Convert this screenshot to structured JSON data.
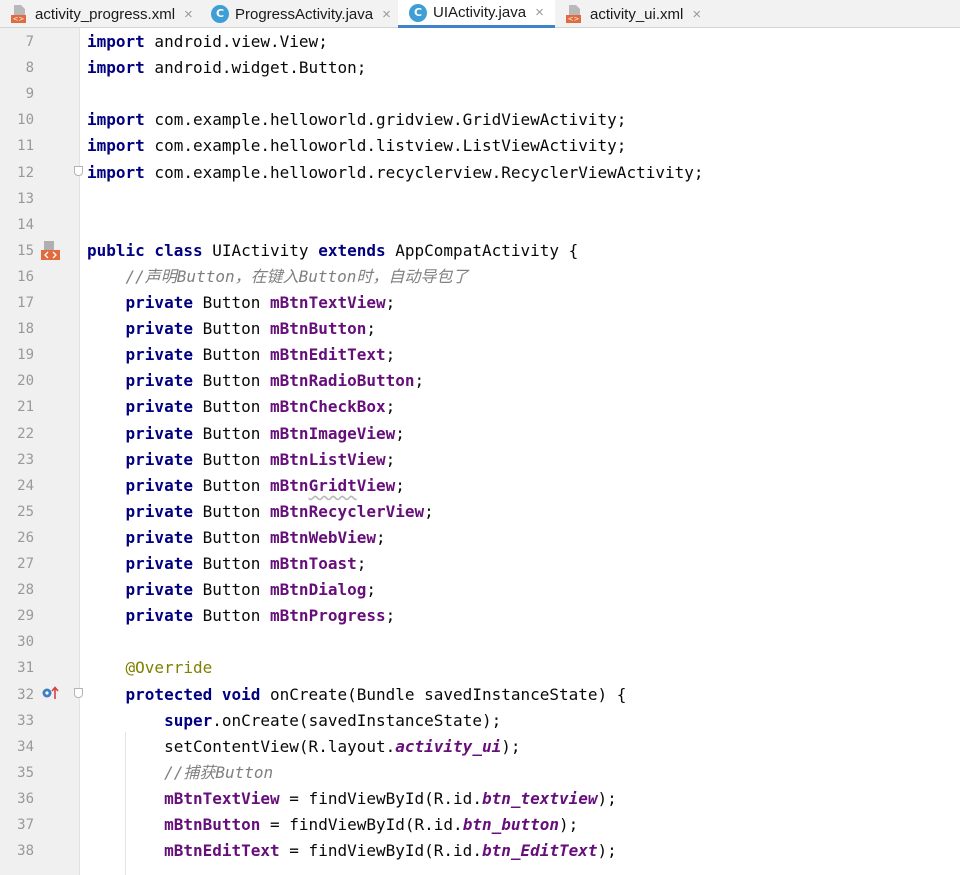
{
  "tabs": [
    {
      "label": "activity_progress.xml",
      "icon": "xml-file-icon",
      "active": false
    },
    {
      "label": "ProgressActivity.java",
      "icon": "java-class-icon",
      "active": false
    },
    {
      "label": "UIActivity.java",
      "icon": "java-class-icon",
      "active": true
    },
    {
      "label": "activity_ui.xml",
      "icon": "xml-file-icon",
      "active": false
    }
  ],
  "tab_close_glyph": "×",
  "icon_text": {
    "class_letter": "C",
    "xml_badge": "<>"
  },
  "editor": {
    "line_numbers": [
      "7",
      "8",
      "9",
      "10",
      "11",
      "12",
      "13",
      "14",
      "15",
      "16",
      "17",
      "18",
      "19",
      "20",
      "21",
      "22",
      "23",
      "24",
      "25",
      "26",
      "27",
      "28",
      "29",
      "30",
      "31",
      "32",
      "33",
      "34",
      "35",
      "36",
      "37",
      "38"
    ],
    "lines": [
      [
        {
          "t": "import",
          "c": "kw"
        },
        {
          "t": " android.view.View;"
        }
      ],
      [
        {
          "t": "import",
          "c": "kw"
        },
        {
          "t": " android.widget.Button;"
        }
      ],
      [],
      [
        {
          "t": "import",
          "c": "kw"
        },
        {
          "t": " com.example.helloworld.gridview.GridViewActivity;"
        }
      ],
      [
        {
          "t": "import",
          "c": "kw"
        },
        {
          "t": " com.example.helloworld.listview.ListViewActivity;"
        }
      ],
      [
        {
          "t": "import",
          "c": "kw"
        },
        {
          "t": " com.example.helloworld.recyclerview.RecyclerViewActivity;"
        }
      ],
      [],
      [],
      [
        {
          "t": "public class",
          "c": "kw"
        },
        {
          "t": " UIActivity "
        },
        {
          "t": "extends",
          "c": "kw"
        },
        {
          "t": " AppCompatActivity {"
        }
      ],
      [
        {
          "t": "    "
        },
        {
          "t": "//声明Button，在键入Button时，自动导包了",
          "c": "cmt"
        }
      ],
      [
        {
          "t": "    "
        },
        {
          "t": "private",
          "c": "kw"
        },
        {
          "t": " Button "
        },
        {
          "t": "mBtnTextView",
          "c": "fld"
        },
        {
          "t": ";"
        }
      ],
      [
        {
          "t": "    "
        },
        {
          "t": "private",
          "c": "kw"
        },
        {
          "t": " Button "
        },
        {
          "t": "mBtnButton",
          "c": "fld"
        },
        {
          "t": ";"
        }
      ],
      [
        {
          "t": "    "
        },
        {
          "t": "private",
          "c": "kw"
        },
        {
          "t": " Button "
        },
        {
          "t": "mBtnEditText",
          "c": "fld"
        },
        {
          "t": ";"
        }
      ],
      [
        {
          "t": "    "
        },
        {
          "t": "private",
          "c": "kw"
        },
        {
          "t": " Button "
        },
        {
          "t": "mBtnRadioButton",
          "c": "fld"
        },
        {
          "t": ";"
        }
      ],
      [
        {
          "t": "    "
        },
        {
          "t": "private",
          "c": "kw"
        },
        {
          "t": " Button "
        },
        {
          "t": "mBtnCheckBox",
          "c": "fld"
        },
        {
          "t": ";"
        }
      ],
      [
        {
          "t": "    "
        },
        {
          "t": "private",
          "c": "kw"
        },
        {
          "t": " Button "
        },
        {
          "t": "mBtnImageView",
          "c": "fld"
        },
        {
          "t": ";"
        }
      ],
      [
        {
          "t": "    "
        },
        {
          "t": "private",
          "c": "kw"
        },
        {
          "t": " Button "
        },
        {
          "t": "mBtnListView",
          "c": "fld"
        },
        {
          "t": ";"
        }
      ],
      [
        {
          "t": "    "
        },
        {
          "t": "private",
          "c": "kw"
        },
        {
          "t": " Button "
        },
        {
          "t": "mBtn",
          "c": "fld"
        },
        {
          "t": "Gridt",
          "c": "fld squig"
        },
        {
          "t": "View",
          "c": "fld"
        },
        {
          "t": ";"
        }
      ],
      [
        {
          "t": "    "
        },
        {
          "t": "private",
          "c": "kw"
        },
        {
          "t": " Button "
        },
        {
          "t": "mBtnRecyclerView",
          "c": "fld"
        },
        {
          "t": ";"
        }
      ],
      [
        {
          "t": "    "
        },
        {
          "t": "private",
          "c": "kw"
        },
        {
          "t": " Button "
        },
        {
          "t": "mBtnWebView",
          "c": "fld"
        },
        {
          "t": ";"
        }
      ],
      [
        {
          "t": "    "
        },
        {
          "t": "private",
          "c": "kw"
        },
        {
          "t": " Button "
        },
        {
          "t": "mBtnToast",
          "c": "fld"
        },
        {
          "t": ";"
        }
      ],
      [
        {
          "t": "    "
        },
        {
          "t": "private",
          "c": "kw"
        },
        {
          "t": " Button "
        },
        {
          "t": "mBtnDialog",
          "c": "fld"
        },
        {
          "t": ";"
        }
      ],
      [
        {
          "t": "    "
        },
        {
          "t": "private",
          "c": "kw"
        },
        {
          "t": " Button "
        },
        {
          "t": "mBtnProgress",
          "c": "fld"
        },
        {
          "t": ";"
        }
      ],
      [],
      [
        {
          "t": "    "
        },
        {
          "t": "@Override",
          "c": "ann"
        }
      ],
      [
        {
          "t": "    "
        },
        {
          "t": "protected void",
          "c": "kw"
        },
        {
          "t": " onCreate(Bundle savedInstanceState) {"
        }
      ],
      [
        {
          "t": "        "
        },
        {
          "t": "super",
          "c": "kw"
        },
        {
          "t": ".onCreate(savedInstanceState);"
        }
      ],
      [
        {
          "t": "        setContentView(R.layout."
        },
        {
          "t": "activity_ui",
          "c": "cst"
        },
        {
          "t": ");"
        }
      ],
      [
        {
          "t": "        "
        },
        {
          "t": "//捕获Button",
          "c": "cmt"
        }
      ],
      [
        {
          "t": "        "
        },
        {
          "t": "mBtnTextView",
          "c": "fld"
        },
        {
          "t": " = findViewById(R.id."
        },
        {
          "t": "btn_textview",
          "c": "cst"
        },
        {
          "t": ");"
        }
      ],
      [
        {
          "t": "        "
        },
        {
          "t": "mBtnButton",
          "c": "fld"
        },
        {
          "t": " = findViewById(R.id."
        },
        {
          "t": "btn_button",
          "c": "cst"
        },
        {
          "t": ");"
        }
      ],
      [
        {
          "t": "        "
        },
        {
          "t": "mBtnEditText",
          "c": "fld"
        },
        {
          "t": " = findViewById(R.id."
        },
        {
          "t": "btn_EditText",
          "c": "cst"
        },
        {
          "t": ");"
        }
      ]
    ]
  },
  "colors": {
    "keyword": "#000080",
    "field": "#660e7a",
    "annotation": "#808000",
    "comment": "#808080",
    "line_number": "#999999",
    "active_tab_underline": "#4083c9",
    "gutter_background": "#f0f0f0"
  }
}
